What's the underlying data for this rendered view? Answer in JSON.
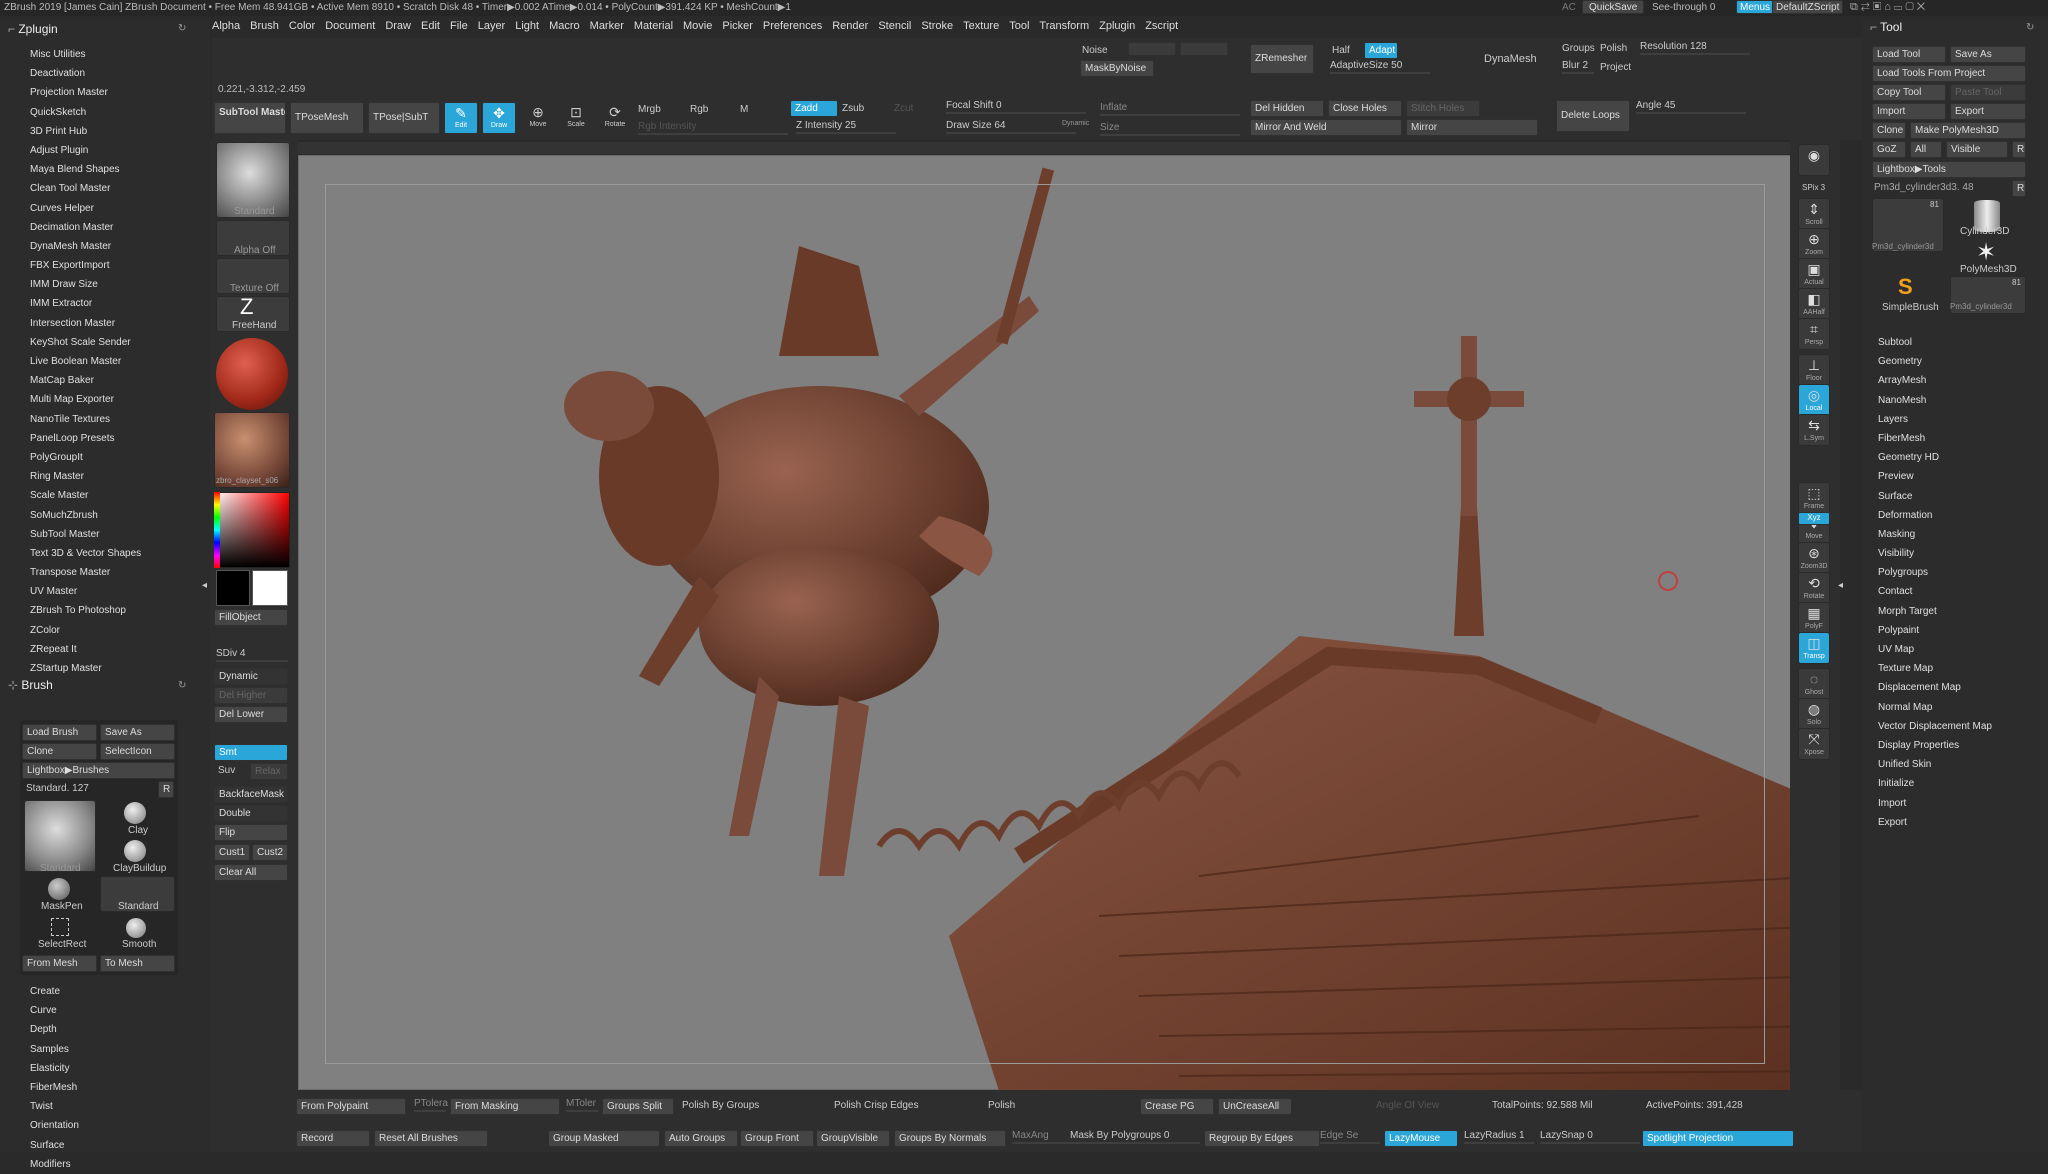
{
  "titlebar": {
    "text": "ZBrush 2019 [James Cain]   ZBrush Document      • Free Mem 48.941GB • Active Mem 8910 • Scratch Disk 48 •  Timer▶0.002 ATime▶0.014 • PolyCount▶391.424 KP • MeshCount▶1",
    "ac": "AC",
    "quicksave": "QuickSave",
    "seethrough": "See-through 0",
    "menus": "Menus",
    "default_zscript": "DefaultZScript"
  },
  "menus": [
    "Alpha",
    "Brush",
    "Color",
    "Document",
    "Draw",
    "Edit",
    "File",
    "Layer",
    "Light",
    "Macro",
    "Marker",
    "Material",
    "Movie",
    "Picker",
    "Preferences",
    "Render",
    "Stencil",
    "Stroke",
    "Texture",
    "Tool",
    "Transform",
    "Zplugin",
    "Zscript"
  ],
  "coords": "0.221,-3.312,-2.459",
  "top": {
    "noise": "Noise",
    "mask_by_noise": "MaskByNoise",
    "zremesher": "ZRemesher",
    "half": "Half",
    "adapt": "Adapt",
    "adaptive_size": "AdaptiveSize 50",
    "dynamesh": "DynaMesh",
    "groups": "Groups",
    "polish": "Polish",
    "blur": "Blur 2",
    "project": "Project",
    "resolution": "Resolution 128",
    "subtool_master": "SubTool Master",
    "tposemesh": "TPoseMesh",
    "tpose_subt": "TPose|SubT",
    "edit": "Edit",
    "draw": "Draw",
    "move": "Move",
    "scale": "Scale",
    "rotate": "Rotate",
    "mrgb": "Mrgb",
    "rgb": "Rgb",
    "m": "M",
    "rgb_intensity": "Rgb Intensity",
    "zadd": "Zadd",
    "zsub": "Zsub",
    "zcut": "Zcut",
    "z_intensity": "Z Intensity 25",
    "focal_shift": "Focal Shift 0",
    "draw_size": "Draw Size 64",
    "dynamic": "Dynamic",
    "inflate": "Inflate",
    "size": "Size",
    "del_hidden": "Del Hidden",
    "close_holes": "Close Holes",
    "stitch_holes": "Stitch Holes",
    "mirror_and_weld": "Mirror And Weld",
    "mirror": "Mirror",
    "delete_loops": "Delete Loops",
    "angle": "Angle 45"
  },
  "left_panel": {
    "zplugin_title": "Zplugin",
    "plugins": [
      "Misc Utilities",
      "Deactivation",
      "Projection Master",
      "QuickSketch",
      "3D Print Hub",
      "Adjust Plugin",
      "Maya Blend Shapes",
      "Clean Tool Master",
      "Curves Helper",
      "Decimation Master",
      "DynaMesh Master",
      "FBX ExportImport",
      "IMM Draw Size",
      "IMM Extractor",
      "Intersection Master",
      "KeyShot Scale Sender",
      "Live Boolean Master",
      "MatCap Baker",
      "Multi Map Exporter",
      "NanoTile Textures",
      "PanelLoop Presets",
      "PolyGroupIt",
      "Ring Master",
      "Scale Master",
      "SoMuchZbrush",
      "SubTool Master",
      "Text 3D & Vector Shapes",
      "Transpose Master",
      "UV Master",
      "ZBrush To Photoshop",
      "ZColor",
      "ZRepeat It",
      "ZStartup Master"
    ],
    "brush_title": "Brush",
    "load_brush": "Load Brush",
    "save_as": "Save As",
    "clone": "Clone",
    "select_icon": "SelectIcon",
    "lightbox_brushes": "Lightbox▶Brushes",
    "standard_count": "Standard. 127",
    "r": "R",
    "brushes": [
      "Standard",
      "Clay",
      "ClayBuildup",
      "MaskPen",
      "Standard",
      "SelectRect",
      "Smooth"
    ],
    "from_mesh": "From Mesh",
    "to_mesh": "To Mesh",
    "brush_sub": [
      "Create",
      "Curve",
      "Depth",
      "Samples",
      "Elasticity",
      "FiberMesh",
      "Twist",
      "Orientation",
      "Surface",
      "Modifiers"
    ]
  },
  "shelf": {
    "standard": "Standard",
    "alpha_off": "Alpha Off",
    "texture_off": "Texture Off",
    "freehand": "FreeHand",
    "material": "zbro_clayset_s06",
    "fill_object": "FillObject",
    "sdiv": "SDiv 4",
    "dynamic": "Dynamic",
    "del_higher": "Del Higher",
    "del_lower": "Del Lower",
    "smt": "Smt",
    "suv": "Suv",
    "relax": "Relax",
    "backface_mask": "BackfaceMask",
    "double": "Double",
    "flip": "Flip",
    "cust1": "Cust1",
    "cust2": "Cust2",
    "clear_all": "Clear All"
  },
  "right_tools": [
    "Scroll",
    "Zoom",
    "Actual",
    "AAHalf",
    "Persp",
    "Floor",
    "Local",
    "L.Sym",
    "Frame",
    "Move",
    "Zoom3D",
    "Rotate",
    "PolyF",
    "Transp",
    "Ghost",
    "Solo",
    "Xpose"
  ],
  "spix": "SPix 3",
  "xyz": "Xyz",
  "tool_panel": {
    "title": "Tool",
    "load_tool": "Load Tool",
    "save_as": "Save As",
    "load_from_project": "Load Tools From Project",
    "copy_tool": "Copy Tool",
    "paste_tool": "Paste Tool",
    "import": "Import",
    "export": "Export",
    "clone": "Clone",
    "make_polymesh": "Make PolyMesh3D",
    "goz": "GoZ",
    "all": "All",
    "visible": "Visible",
    "r": "R",
    "lightbox_tools": "Lightbox▶Tools",
    "current_tool": "Pm3d_cylinder3d3. 48",
    "thumbs": [
      "Pm3d_cylinder3d",
      "Cylinder3D",
      "PolyMesh3D",
      "SimpleBrush",
      "Pm3d_cylinder3d"
    ],
    "thumb_count": "81",
    "sections": [
      "Subtool",
      "Geometry",
      "ArrayMesh",
      "NanoMesh",
      "Layers",
      "FiberMesh",
      "Geometry HD",
      "Preview",
      "Surface",
      "Deformation",
      "Masking",
      "Visibility",
      "Polygroups",
      "Contact",
      "Morph Target",
      "Polypaint",
      "UV Map",
      "Texture Map",
      "Displacement Map",
      "Normal Map",
      "Vector Displacement Map",
      "Display Properties",
      "Unified Skin",
      "Initialize",
      "Import",
      "Export"
    ]
  },
  "bottom": {
    "from_polypaint": "From Polypaint",
    "ptolerance": "PTolera",
    "from_masking": "From Masking",
    "mtolerance": "MToler",
    "groups_split": "Groups Split",
    "polish_by_groups": "Polish By Groups",
    "polish_crisp_edges": "Polish Crisp Edges",
    "polish": "Polish",
    "crease_pg": "Crease PG",
    "uncrease_all": "UnCreaseAll",
    "angle_of_view": "Angle Of View",
    "total_points": "TotalPoints: 92.588 Mil",
    "active_points": "ActivePoints: 391,428",
    "record": "Record",
    "reset_all_brushes": "Reset All Brushes",
    "group_masked": "Group Masked",
    "auto_groups": "Auto Groups",
    "group_front": "Group Front",
    "group_visible": "GroupVisible",
    "groups_by_normals": "Groups By Normals",
    "max_angle": "MaxAng",
    "mask_by_polygroups": "Mask By Polygroups 0",
    "regroup_by_edges": "Regroup By Edges",
    "edge_sensitivity": "Edge Se",
    "lazymouse": "LazyMouse",
    "lazyradius": "LazyRadius 1",
    "lazysnap": "LazySnap 0",
    "spotlight_projection": "Spotlight Projection"
  },
  "colors": {
    "accent": "#2aa6d8",
    "clay": "#7a4a3a",
    "bg": "#808080"
  }
}
